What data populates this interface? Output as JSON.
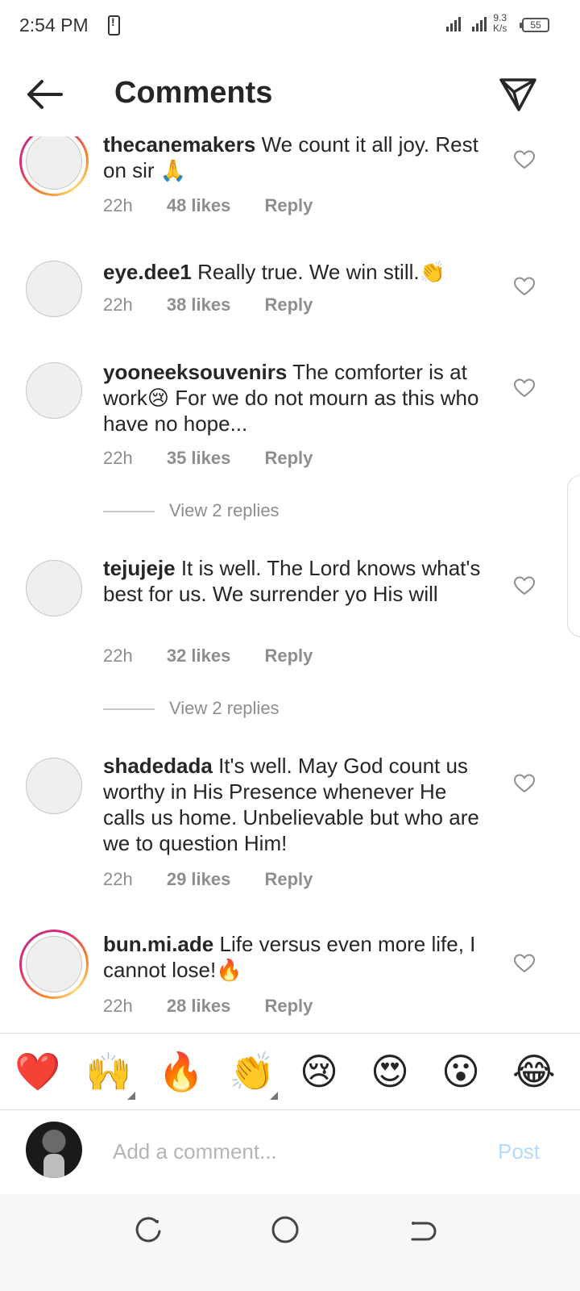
{
  "status_bar": {
    "time": "2:54 PM",
    "network_speed_value": "9.3",
    "network_speed_unit": "K/s",
    "battery": "55",
    "icons": [
      "phone-alert-icon",
      "signal-icon",
      "battery-icon"
    ]
  },
  "header": {
    "title": "Comments",
    "back_icon": "arrow-left-icon",
    "share_icon": "paper-plane-icon"
  },
  "comments": [
    {
      "username": "thecanemakers",
      "text": "We count it all joy. Rest on sir 🙏",
      "time": "22h",
      "likes": "48 likes",
      "reply": "Reply",
      "story_ring": true
    },
    {
      "username": "eye.dee1",
      "text": "Really true. We win still.👏",
      "time": "22h",
      "likes": "38 likes",
      "reply": "Reply",
      "story_ring": false
    },
    {
      "username": "yooneeksouvenirs",
      "text": "The comforter is at work😢 For we do not mourn as this who have no hope...",
      "time": "22h",
      "likes": "35 likes",
      "reply": "Reply",
      "story_ring": false,
      "view_replies": "View 2 replies"
    },
    {
      "username": "tejujeje",
      "text": "It is well. The Lord knows what's best for us. We surrender yo His will",
      "time": "22h",
      "likes": "32 likes",
      "reply": "Reply",
      "story_ring": false,
      "view_replies": "View 2 replies"
    },
    {
      "username": "shadedada",
      "text": "It's well. May God count us worthy in His Presence whenever He calls us home. Unbelievable but who are we to question Him!",
      "time": "22h",
      "likes": "29 likes",
      "reply": "Reply",
      "story_ring": false
    },
    {
      "username": "bun.mi.ade",
      "text": "Life versus even more life, I cannot lose!🔥",
      "time": "22h",
      "likes": "28 likes",
      "reply": "Reply",
      "story_ring": true
    }
  ],
  "emoji_bar": [
    "❤️",
    "🙌",
    "🔥",
    "👏",
    "😢",
    "😍",
    "😮",
    "😂"
  ],
  "composer": {
    "placeholder": "Add a comment...",
    "post_label": "Post"
  },
  "nav": {
    "icons": [
      "recent-apps-icon",
      "home-icon",
      "back-icon"
    ]
  },
  "colors": {
    "text": "#262626",
    "secondary": "#8e8e8e",
    "post_disabled": "#b3dbff",
    "heart_red": "#e0242f"
  }
}
